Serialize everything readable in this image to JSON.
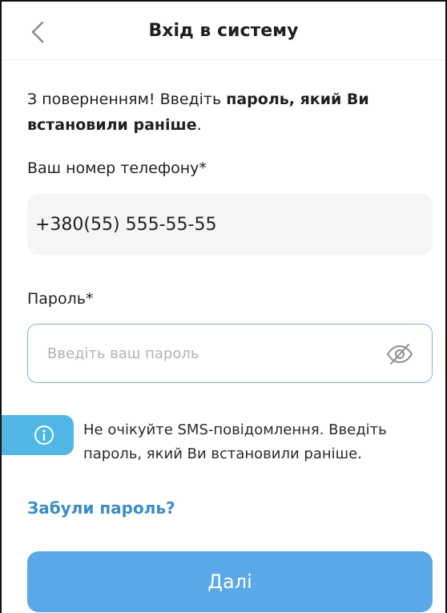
{
  "header": {
    "title": "Вхід в систему",
    "back_icon": "chevron-left-icon"
  },
  "intro": {
    "plain": "З поверненням! Введіть ",
    "bold": "пароль, який Ви встановили раніше",
    "end": "."
  },
  "phone": {
    "label": "Ваш номер телефону*",
    "value": "+380(55) 555-55-55"
  },
  "password": {
    "label": "Пароль*",
    "placeholder": "Введіть ваш пароль",
    "toggle_icon": "eye-off-icon"
  },
  "info": {
    "icon": "info-icon",
    "text": "Не очікуйте SMS-повідомлення. Введіть пароль, який Ви встановили раніше."
  },
  "forgot_link": "Забули пароль?",
  "next_button": "Далі",
  "colors": {
    "accent": "#5aa8e8",
    "link": "#3a8ec8",
    "info": "#4fb6e6",
    "field_border": "#7fb1d6"
  }
}
